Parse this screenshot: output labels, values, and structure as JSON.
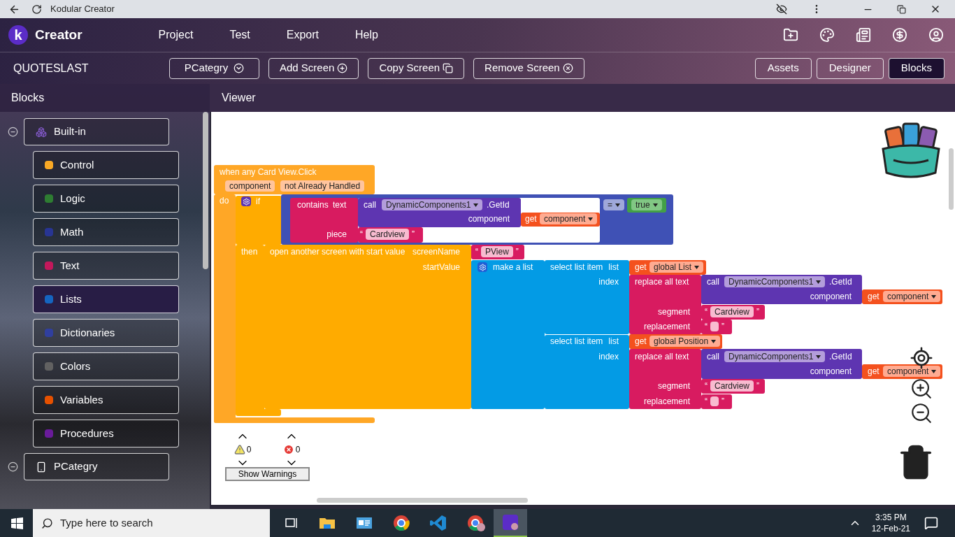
{
  "browser": {
    "title": "Kodular Creator"
  },
  "app_bar": {
    "logo_letter": "k",
    "brand": "Creator",
    "menu": [
      "Project",
      "Test",
      "Export",
      "Help"
    ]
  },
  "toolbar": {
    "project": "QUOTESLAST",
    "screen_select": "PCategry",
    "actions": [
      "Add Screen",
      "Copy Screen",
      "Remove Screen"
    ],
    "views": [
      {
        "label": "Assets",
        "selected": false
      },
      {
        "label": "Designer",
        "selected": false
      },
      {
        "label": "Blocks",
        "selected": true
      }
    ]
  },
  "sidebar": {
    "title": "Blocks",
    "tree": [
      {
        "label": "Built-in",
        "expanded": true,
        "children": [
          {
            "label": "Control",
            "selected": false
          },
          {
            "label": "Logic",
            "selected": false
          },
          {
            "label": "Math",
            "selected": false
          },
          {
            "label": "Text",
            "selected": false
          },
          {
            "label": "Lists",
            "selected": true
          },
          {
            "label": "Dictionaries",
            "selected": false
          },
          {
            "label": "Colors",
            "selected": false
          },
          {
            "label": "Variables",
            "selected": false
          },
          {
            "label": "Procedures",
            "selected": false
          }
        ]
      },
      {
        "label": "PCategry",
        "expanded": true
      }
    ]
  },
  "viewer": {
    "title": "Viewer",
    "blocks": [
      {
        "kind": "label",
        "text": "when any Card View.Click"
      },
      {
        "kind": "param",
        "text": "component"
      },
      {
        "kind": "param",
        "text": "not Already Handled"
      },
      {
        "kind": "label",
        "text": "do"
      },
      {
        "kind": "label",
        "text": "if"
      },
      {
        "kind": "label",
        "text": "contains"
      },
      {
        "kind": "label",
        "text": "text"
      },
      {
        "kind": "label",
        "text": "call"
      },
      {
        "kind": "component",
        "text": "DynamicComponents1"
      },
      {
        "kind": "label",
        "text": ".GetId"
      },
      {
        "kind": "label",
        "text": "component"
      },
      {
        "kind": "label",
        "text": "get"
      },
      {
        "kind": "var",
        "text": "component"
      },
      {
        "kind": "label",
        "text": "piece"
      },
      {
        "kind": "string",
        "open": "“",
        "text": "Cardview",
        "close": "”"
      },
      {
        "kind": "op",
        "text": "="
      },
      {
        "kind": "bool",
        "text": "true"
      },
      {
        "kind": "label",
        "text": "then"
      },
      {
        "kind": "label",
        "text": "open another screen with start value"
      },
      {
        "kind": "label",
        "text": "screenName"
      },
      {
        "kind": "string",
        "open": "“",
        "text": "PView",
        "close": "”"
      },
      {
        "kind": "label",
        "text": "startValue"
      },
      {
        "kind": "label",
        "text": "make a list"
      },
      {
        "kind": "label",
        "text": "select list item"
      },
      {
        "kind": "label",
        "text": "list"
      },
      {
        "kind": "label",
        "text": "get"
      },
      {
        "kind": "var",
        "text": "global List"
      },
      {
        "kind": "label",
        "text": "index"
      },
      {
        "kind": "label",
        "text": "replace all text"
      },
      {
        "kind": "label",
        "text": "call"
      },
      {
        "kind": "component",
        "text": "DynamicComponents1"
      },
      {
        "kind": "label",
        "text": ".GetId"
      },
      {
        "kind": "label",
        "text": "component"
      },
      {
        "kind": "label",
        "text": "get"
      },
      {
        "kind": "var",
        "text": "component"
      },
      {
        "kind": "label",
        "text": "segment"
      },
      {
        "kind": "string",
        "open": "“",
        "text": "Cardview",
        "close": "”"
      },
      {
        "kind": "label",
        "text": "replacement"
      },
      {
        "kind": "empty-string",
        "open": "“",
        "close": "”"
      },
      {
        "kind": "label",
        "text": "select list item"
      },
      {
        "kind": "label",
        "text": "list"
      },
      {
        "kind": "label",
        "text": "get"
      },
      {
        "kind": "var",
        "text": "global Position"
      },
      {
        "kind": "label",
        "text": "index"
      },
      {
        "kind": "label",
        "text": "replace all text"
      },
      {
        "kind": "label",
        "text": "call"
      },
      {
        "kind": "component",
        "text": "DynamicComponents1"
      },
      {
        "kind": "label",
        "text": ".GetId"
      },
      {
        "kind": "label",
        "text": "component"
      },
      {
        "kind": "label",
        "text": "get"
      },
      {
        "kind": "var",
        "text": "component"
      },
      {
        "kind": "label",
        "text": "segment"
      },
      {
        "kind": "string",
        "open": "“",
        "text": "Cardview",
        "close": "”"
      },
      {
        "kind": "label",
        "text": "replacement"
      },
      {
        "kind": "empty-string",
        "open": "“",
        "close": "”"
      }
    ],
    "warnings": {
      "warning_count": "0",
      "error_count": "0",
      "button": "Show Warnings"
    }
  },
  "taskbar": {
    "search_placeholder": "Type here to search",
    "time": "3:35 PM",
    "date": "12-Feb-21"
  }
}
